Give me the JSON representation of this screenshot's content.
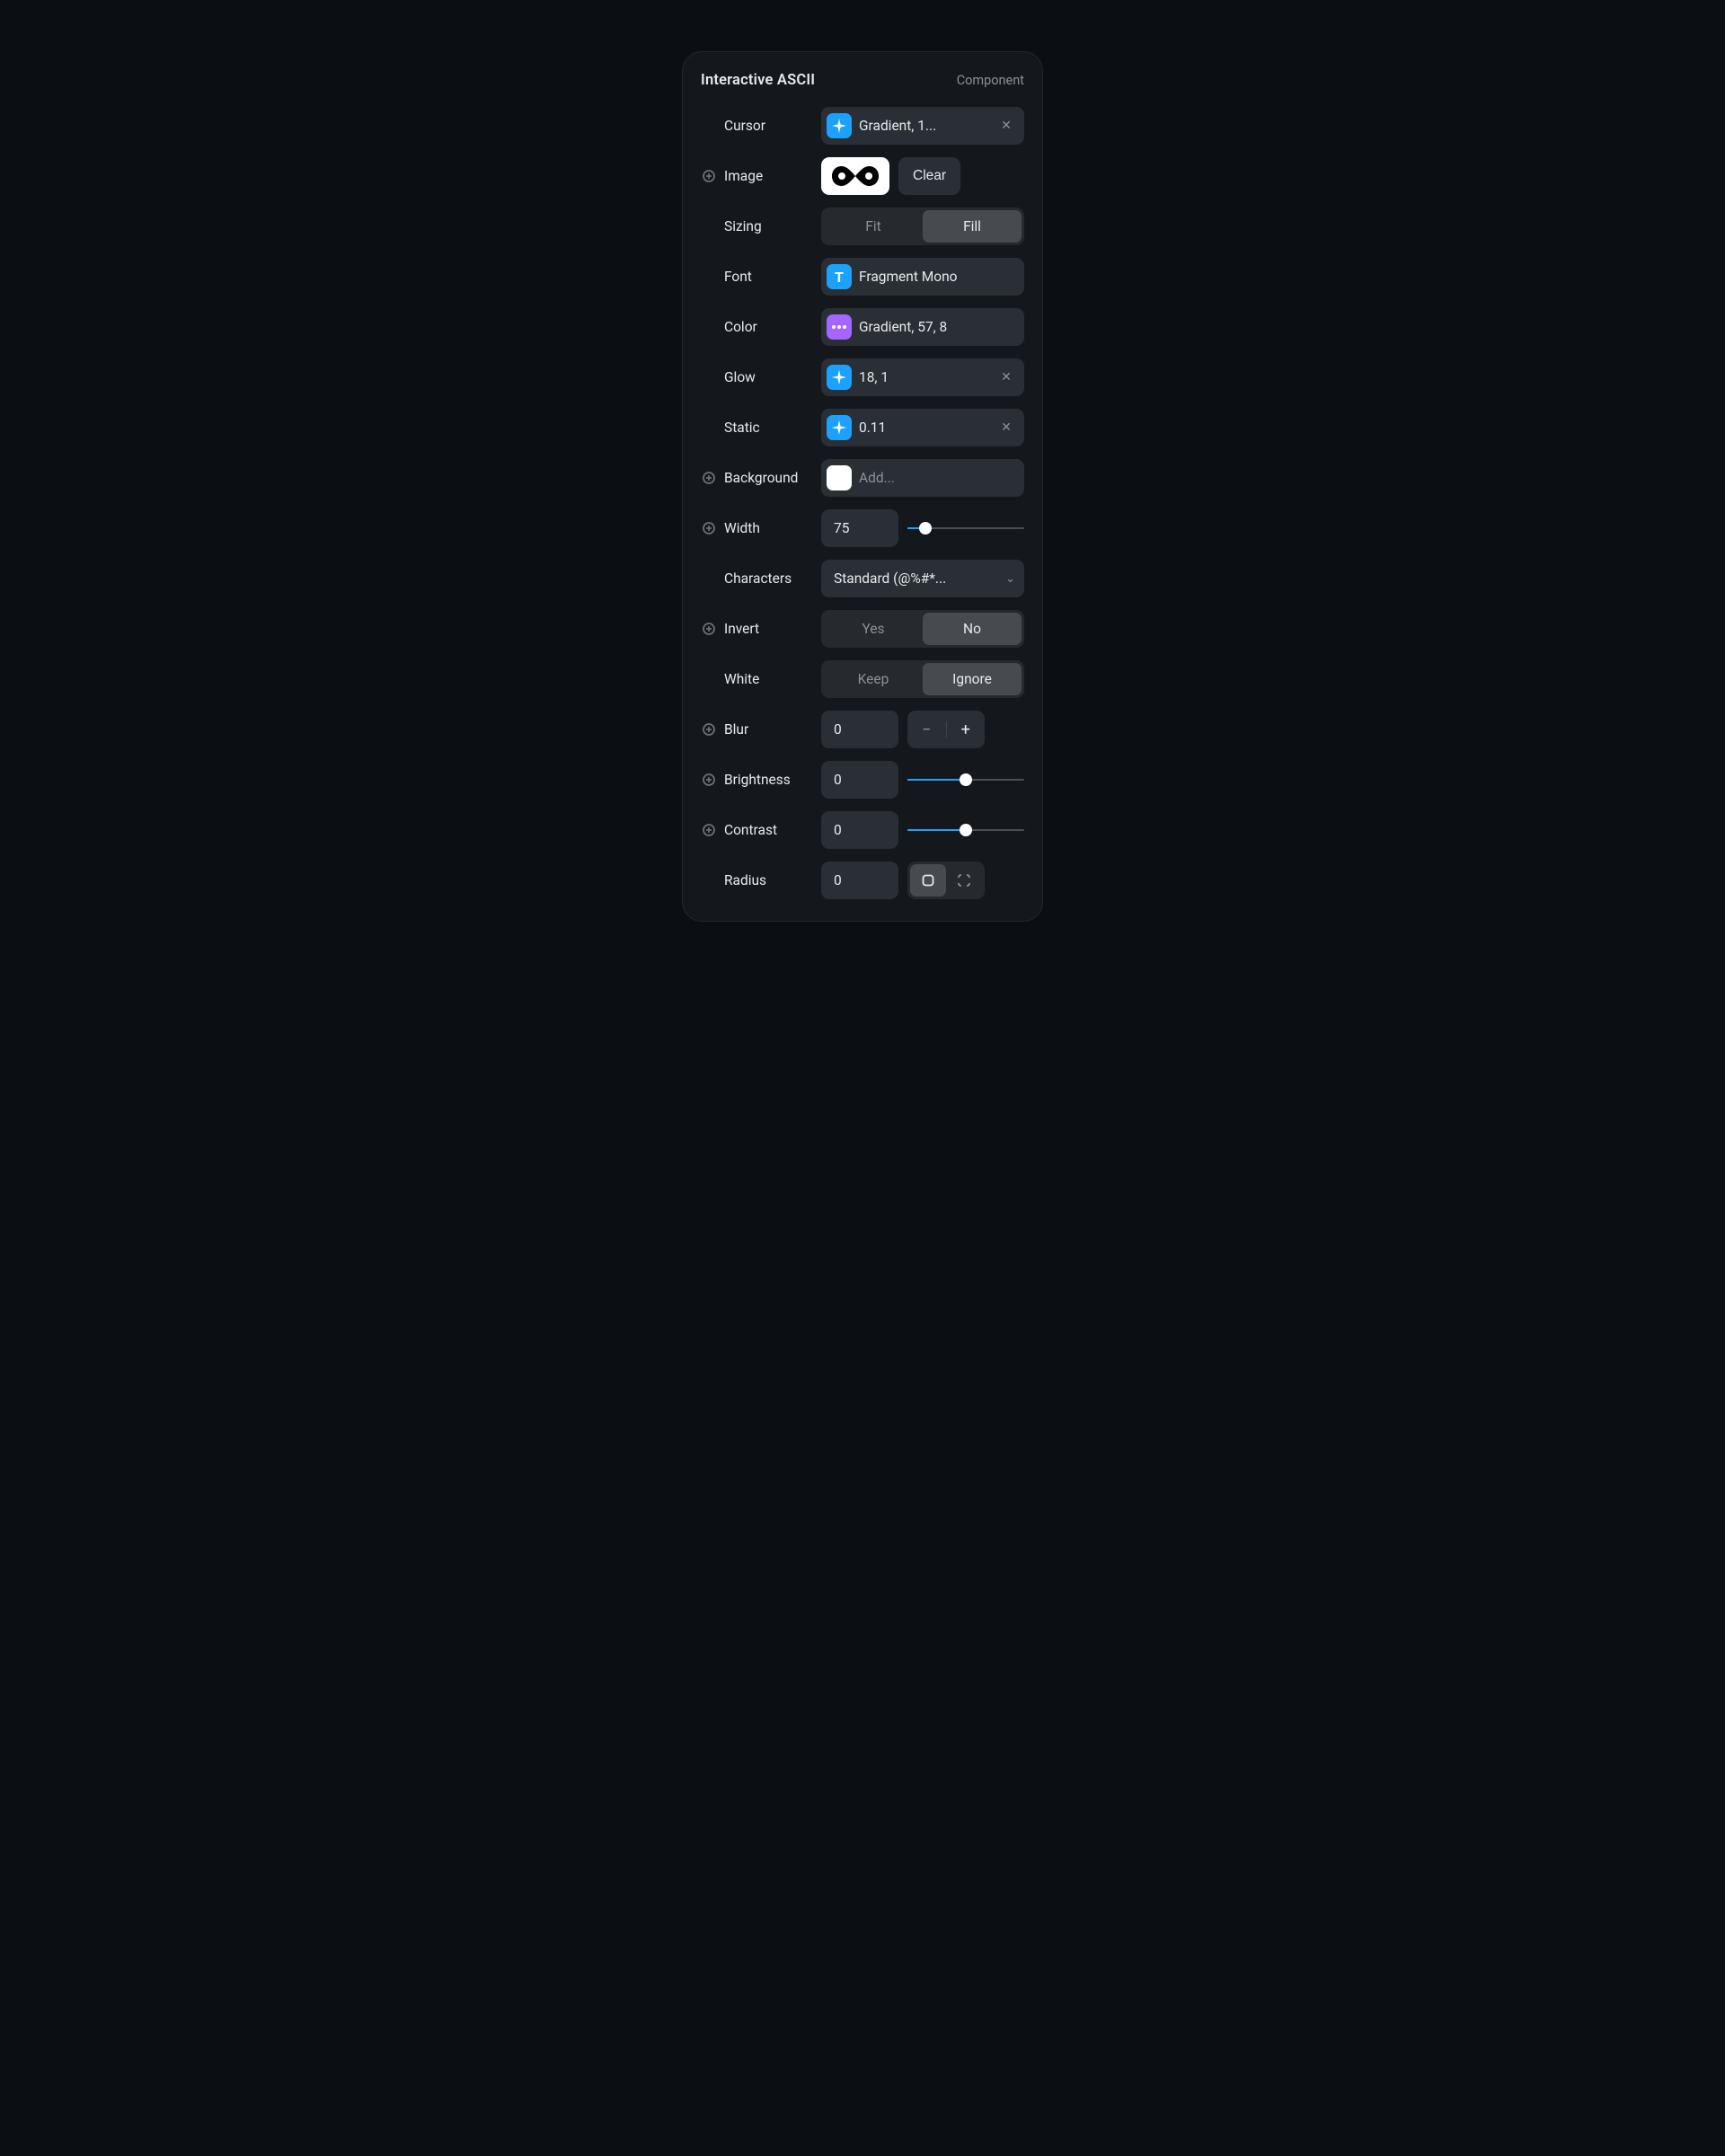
{
  "header": {
    "title": "Interactive ASCII",
    "subtitle": "Component"
  },
  "cursor": {
    "label": "Cursor",
    "value": "Gradient, 1...",
    "icon": "sparkle",
    "clearable": true
  },
  "image": {
    "label": "Image",
    "clear_label": "Clear",
    "has_plus": true
  },
  "sizing": {
    "label": "Sizing",
    "options": [
      "Fit",
      "Fill"
    ],
    "active": "Fill"
  },
  "font": {
    "label": "Font",
    "value": "Fragment Mono",
    "icon": "T"
  },
  "color": {
    "label": "Color",
    "value": "Gradient, 57, 8",
    "icon": "dots"
  },
  "glow": {
    "label": "Glow",
    "value": "18, 1",
    "icon": "sparkle",
    "clearable": true
  },
  "static": {
    "label": "Static",
    "value": "0.11",
    "icon": "sparkle",
    "clearable": true
  },
  "background": {
    "label": "Background",
    "placeholder": "Add...",
    "has_plus": true
  },
  "width": {
    "label": "Width",
    "value": "75",
    "slider_percent": 15,
    "has_plus": true
  },
  "characters": {
    "label": "Characters",
    "value": "Standard (@%#*..."
  },
  "invert": {
    "label": "Invert",
    "options": [
      "Yes",
      "No"
    ],
    "active": "No",
    "has_plus": true
  },
  "white": {
    "label": "White",
    "options": [
      "Keep",
      "Ignore"
    ],
    "active": "Ignore"
  },
  "blur": {
    "label": "Blur",
    "value": "0",
    "has_plus": true
  },
  "brightness": {
    "label": "Brightness",
    "value": "0",
    "slider_percent": 50,
    "has_plus": true
  },
  "contrast": {
    "label": "Contrast",
    "value": "0",
    "slider_percent": 50,
    "has_plus": true
  },
  "radius": {
    "label": "Radius",
    "value": "0",
    "mode": "single"
  }
}
